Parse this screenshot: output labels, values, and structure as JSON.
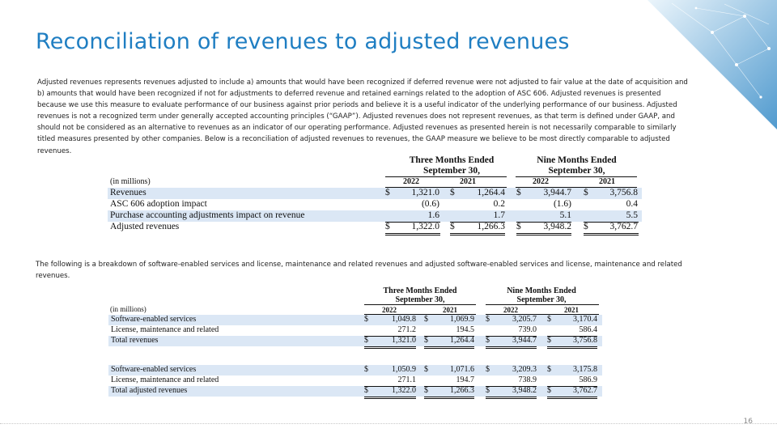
{
  "slide": {
    "title": "Reconciliation of revenues to adjusted revenues",
    "intro": "Adjusted revenues represents revenues adjusted to include a) amounts that would have been recognized if deferred revenue were not adjusted to fair value at the date of acquisition and b) amounts that would have been recognized if not for adjustments to deferred revenue and retained earnings related to the adoption of ASC 606.  Adjusted revenues is presented because we use this measure to evaluate performance of our business against prior periods and believe it is a useful indicator of the underlying performance of our business.  Adjusted revenues is not a recognized term under generally accepted accounting principles (“GAAP”).  Adjusted revenues does not represent revenues, as that term is defined under GAAP, and should not be considered as an alternative to revenues as an indicator of our operating performance.  Adjusted revenues as presented herein is not necessarily comparable to similarly titled measures presented by other companies.  Below is a reconciliation of adjusted revenues to revenues, the GAAP measure we believe to be most directly comparable to adjusted revenues.",
    "breakdown_text": "The following is a breakdown of software-enabled services and license, maintenance and related revenues and adjusted software-enabled services and license, maintenance and related revenues.",
    "page_number": "16"
  },
  "table1": {
    "period_headers": [
      "Three Months Ended",
      "September 30,",
      "Nine Months Ended",
      "September 30,"
    ],
    "years": [
      "2022",
      "2021",
      "2022",
      "2021"
    ],
    "units_label": "(in millions)",
    "rows": [
      {
        "label": "Revenues",
        "d1": "$",
        "v1": "1,321.0",
        "d2": "$",
        "v2": "1,264.4",
        "d3": "$",
        "v3": "3,944.7",
        "d4": "$",
        "v4": "3,756.8"
      },
      {
        "label": "ASC 606 adoption impact",
        "d1": "",
        "v1": "(0.6)",
        "d2": "",
        "v2": "0.2",
        "d3": "",
        "v3": "(1.6)",
        "d4": "",
        "v4": "0.4"
      },
      {
        "label": "Purchase accounting adjustments impact on revenue",
        "d1": "",
        "v1": "1.6",
        "d2": "",
        "v2": "1.7",
        "d3": "",
        "v3": "5.1",
        "d4": "",
        "v4": "5.5"
      },
      {
        "label": "Adjusted revenues",
        "d1": "$",
        "v1": "1,322.0",
        "d2": "$",
        "v2": "1,266.3",
        "d3": "$",
        "v3": "3,948.2",
        "d4": "$",
        "v4": "3,762.7"
      }
    ]
  },
  "table2": {
    "period_headers": [
      "Three Months Ended",
      "September 30,",
      "Nine Months Ended",
      "September 30,"
    ],
    "years": [
      "2022",
      "2021",
      "2022",
      "2021"
    ],
    "units_label": "(in millions)",
    "rows": [
      {
        "label": "Software-enabled services",
        "d1": "$",
        "v1": "1,049.8",
        "d2": "$",
        "v2": "1,069.9",
        "d3": "$",
        "v3": "3,205.7",
        "d4": "$",
        "v4": "3,170.4"
      },
      {
        "label": "License, maintenance and related",
        "d1": "",
        "v1": "271.2",
        "d2": "",
        "v2": "194.5",
        "d3": "",
        "v3": "739.0",
        "d4": "",
        "v4": "586.4"
      },
      {
        "label": "Total revenues",
        "d1": "$",
        "v1": "1,321.0",
        "d2": "$",
        "v2": "1,264.4",
        "d3": "$",
        "v3": "3,944.7",
        "d4": "$",
        "v4": "3,756.8"
      },
      {
        "label": "Software-enabled services",
        "d1": "$",
        "v1": "1,050.9",
        "d2": "$",
        "v2": "1,071.6",
        "d3": "$",
        "v3": "3,209.3",
        "d4": "$",
        "v4": "3,175.8"
      },
      {
        "label": "License, maintenance and related",
        "d1": "",
        "v1": "271.1",
        "d2": "",
        "v2": "194.7",
        "d3": "",
        "v3": "738.9",
        "d4": "",
        "v4": "586.9"
      },
      {
        "label": "Total adjusted revenues",
        "d1": "$",
        "v1": "1,322.0",
        "d2": "$",
        "v2": "1,266.3",
        "d3": "$",
        "v3": "3,948.2",
        "d4": "$",
        "v4": "3,762.7"
      }
    ]
  }
}
